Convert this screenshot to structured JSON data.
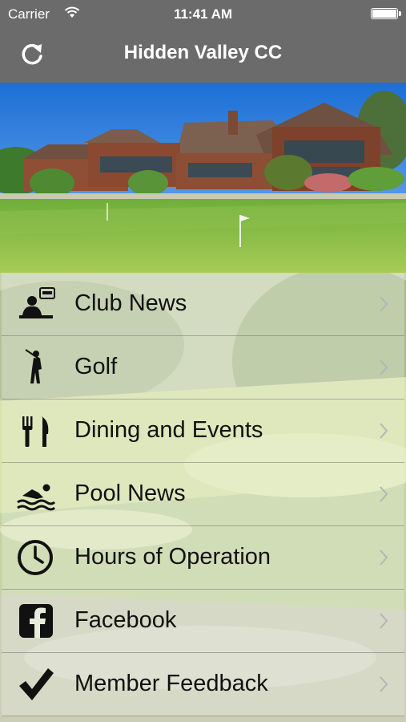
{
  "status_bar": {
    "carrier": "Carrier",
    "time": "11:41 AM"
  },
  "nav": {
    "title": "Hidden Valley CC",
    "refresh_icon": "refresh-icon"
  },
  "menu": {
    "items": [
      {
        "label": "Club News",
        "icon": "news-icon"
      },
      {
        "label": "Golf",
        "icon": "golfer-icon"
      },
      {
        "label": "Dining and Events",
        "icon": "fork-knife-icon"
      },
      {
        "label": "Pool News",
        "icon": "swimmer-icon"
      },
      {
        "label": "Hours of Operation",
        "icon": "clock-icon"
      },
      {
        "label": "Facebook",
        "icon": "facebook-icon"
      },
      {
        "label": "Member Feedback",
        "icon": "checkmark-icon"
      }
    ]
  },
  "colors": {
    "nav_bar": "#6b6b6b",
    "text": "#111111",
    "chevron": "#b5b5b5"
  }
}
